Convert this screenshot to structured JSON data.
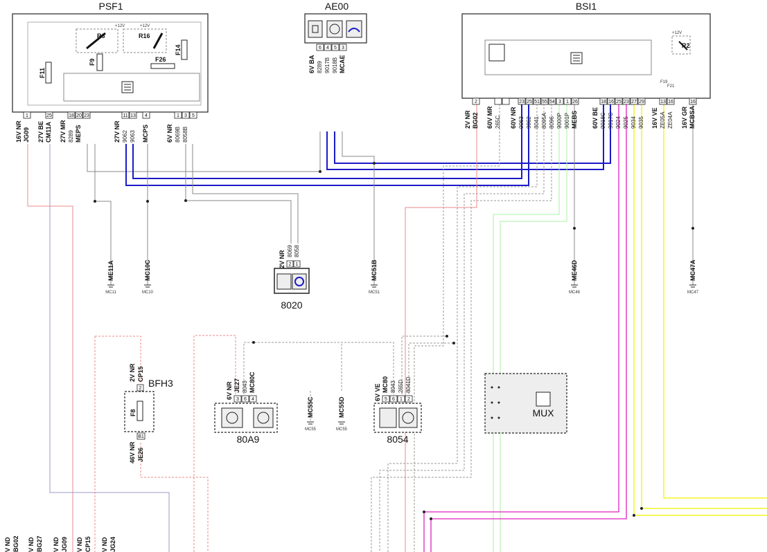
{
  "colors": {
    "red": "#e04040",
    "blue": "#1a1ac8",
    "green": "#1a7a3a",
    "magenta": "#e020c0",
    "yellow": "#f0f000",
    "lightgreen": "#a8f0a0",
    "gray": "#888888"
  },
  "components": {
    "psf1": {
      "name": "PSF1",
      "relays": [
        "R6",
        "R16"
      ],
      "fuses": [
        "F9",
        "F11",
        "F14",
        "F26"
      ],
      "supply": "+12V"
    },
    "ae00": {
      "name": "AE00",
      "icons": [
        "chip-icon",
        "motor-icon",
        "pump-icon"
      ]
    },
    "bsi1": {
      "name": "BSI1",
      "relay": "R2",
      "fuses": [
        "F19",
        "F21"
      ],
      "supply": "+12V"
    },
    "c8020": {
      "name": "8020"
    },
    "bfh3": {
      "name": "BFH3",
      "fuse": "F8"
    },
    "c80a9": {
      "name": "80A9"
    },
    "c8054": {
      "name": "8054"
    },
    "mux": {
      "name": "MUX"
    }
  },
  "psf1_connectors": [
    {
      "label": "16V NR",
      "pins": [
        "1"
      ],
      "wires": [
        {
          "t": "JG09",
          "c": "red"
        }
      ]
    },
    {
      "label": "27V BE",
      "pins": [
        "25"
      ],
      "wires": [
        {
          "t": "CM11A",
          "c": "blue"
        }
      ]
    },
    {
      "label": "27V MR",
      "pins": [
        "18",
        "20",
        "23"
      ],
      "wires": [
        {
          "t": "8289",
          "c": "black"
        },
        {
          "t": "MEPS",
          "c": "green"
        }
      ]
    },
    {
      "label": "27V NR",
      "pins": [
        "11",
        "13"
      ],
      "wires": [
        {
          "t": "9062",
          "c": "black"
        },
        {
          "t": "9063",
          "c": "black"
        }
      ]
    },
    {
      "label": "",
      "pins": [
        "4"
      ],
      "wires": [
        {
          "t": "MCPS",
          "c": "green"
        }
      ]
    },
    {
      "label": "6V NR",
      "pins": [
        "1",
        "3",
        "5"
      ],
      "wires": [
        {
          "t": "8069B",
          "c": "black"
        },
        {
          "t": "8058B",
          "c": "black"
        }
      ]
    }
  ],
  "ae00_connector": {
    "label": "6V BA",
    "pins": [
      "6",
      "4",
      "5",
      "3"
    ],
    "wires": [
      {
        "t": "8289",
        "c": "black"
      },
      {
        "t": "9017B",
        "c": "black"
      },
      {
        "t": "9018B",
        "c": "black"
      },
      {
        "t": "MCAE",
        "c": "green"
      }
    ]
  },
  "bsi1_connectors": [
    {
      "label": "2V NR",
      "pins": [
        "2"
      ],
      "wires": [
        {
          "t": "BG02",
          "c": "red"
        }
      ]
    },
    {
      "label": "60V MR",
      "pins": [
        "",
        ""
      ],
      "wires": [
        {
          "t": "265C",
          "c": "black"
        }
      ]
    },
    {
      "label": "60V NR",
      "pins": [
        "23",
        "25",
        "51",
        "55",
        "54",
        "3",
        "1",
        "26"
      ],
      "wires": [
        {
          "t": "9063",
          "c": "black"
        },
        {
          "t": "9062",
          "c": "black"
        },
        {
          "t": "8041",
          "c": "black"
        },
        {
          "t": "8095A",
          "c": "black"
        },
        {
          "t": "8096",
          "c": "black"
        },
        {
          "t": "9000P",
          "c": "black"
        },
        {
          "t": "9001P",
          "c": "black"
        },
        {
          "t": "MEBS",
          "c": "green"
        }
      ]
    },
    {
      "label": "60V BE",
      "pins": [
        "18",
        "16",
        "25",
        "23",
        "27",
        "29"
      ],
      "wires": [
        {
          "t": "9018C",
          "c": "black"
        },
        {
          "t": "9017C",
          "c": "black"
        },
        {
          "t": "9024",
          "c": "black"
        },
        {
          "t": "9025",
          "c": "black"
        },
        {
          "t": "9034",
          "c": "black"
        },
        {
          "t": "9035",
          "c": "black"
        }
      ]
    },
    {
      "label": "16V VE",
      "pins": [
        "13",
        "16"
      ],
      "wires": [
        {
          "t": "ZE05A",
          "c": "black"
        },
        {
          "t": "ZE04A",
          "c": "black"
        }
      ]
    },
    {
      "label": "16V GR",
      "pins": [
        "16"
      ],
      "wires": [
        {
          "t": "MCBSA",
          "c": "green"
        }
      ]
    }
  ],
  "c8020_connector": {
    "label": "2V NR",
    "pins": [
      "2",
      "1"
    ],
    "wires": [
      {
        "t": "8069",
        "c": "black"
      },
      {
        "t": "8058",
        "c": "black"
      }
    ]
  },
  "bfh3_top": {
    "label": "2V NR",
    "pin": "2",
    "wire": {
      "t": "CP15",
      "c": "red"
    }
  },
  "bfh3_bottom": {
    "label": "46V NR",
    "pin": "B1",
    "wire": {
      "t": "JE26",
      "c": "red"
    }
  },
  "c80a9_connector": {
    "label": "6V NR",
    "pins": [
      "3",
      "6",
      "4"
    ],
    "wires": [
      {
        "t": "JE27",
        "c": "red"
      },
      {
        "t": "8043",
        "c": "black"
      },
      {
        "t": "MC80C",
        "c": "green"
      }
    ]
  },
  "c8054_connector": {
    "label": "6V VE",
    "pins": [
      "5",
      "6",
      "1",
      "2"
    ],
    "wires": [
      {
        "t": "MC80",
        "c": "green"
      },
      {
        "t": "8043",
        "c": "black"
      },
      {
        "t": "265D",
        "c": "black"
      },
      {
        "t": "8041D",
        "c": "black"
      }
    ]
  },
  "grounds": [
    {
      "wire": "ME11A",
      "name": "MC11"
    },
    {
      "wire": "MC10C",
      "name": "MC10"
    },
    {
      "wire": "MC51B",
      "name": "MC51"
    },
    {
      "wire": "ME46D",
      "name": "MC46"
    },
    {
      "wire": "MC47A",
      "name": "MC47"
    },
    {
      "wire": "MC55C",
      "name": "MC55"
    },
    {
      "wire": "MC55D",
      "name": "MC55"
    }
  ],
  "bottom_labels": [
    {
      "prefix": "V ND",
      "wire": "BG02"
    },
    {
      "prefix": "V ND",
      "wire": "BG27"
    },
    {
      "prefix": "V ND",
      "wire": "JG09"
    },
    {
      "prefix": "V ND",
      "wire": "CP15"
    },
    {
      "prefix": "V ND",
      "wire": "JG24"
    }
  ]
}
